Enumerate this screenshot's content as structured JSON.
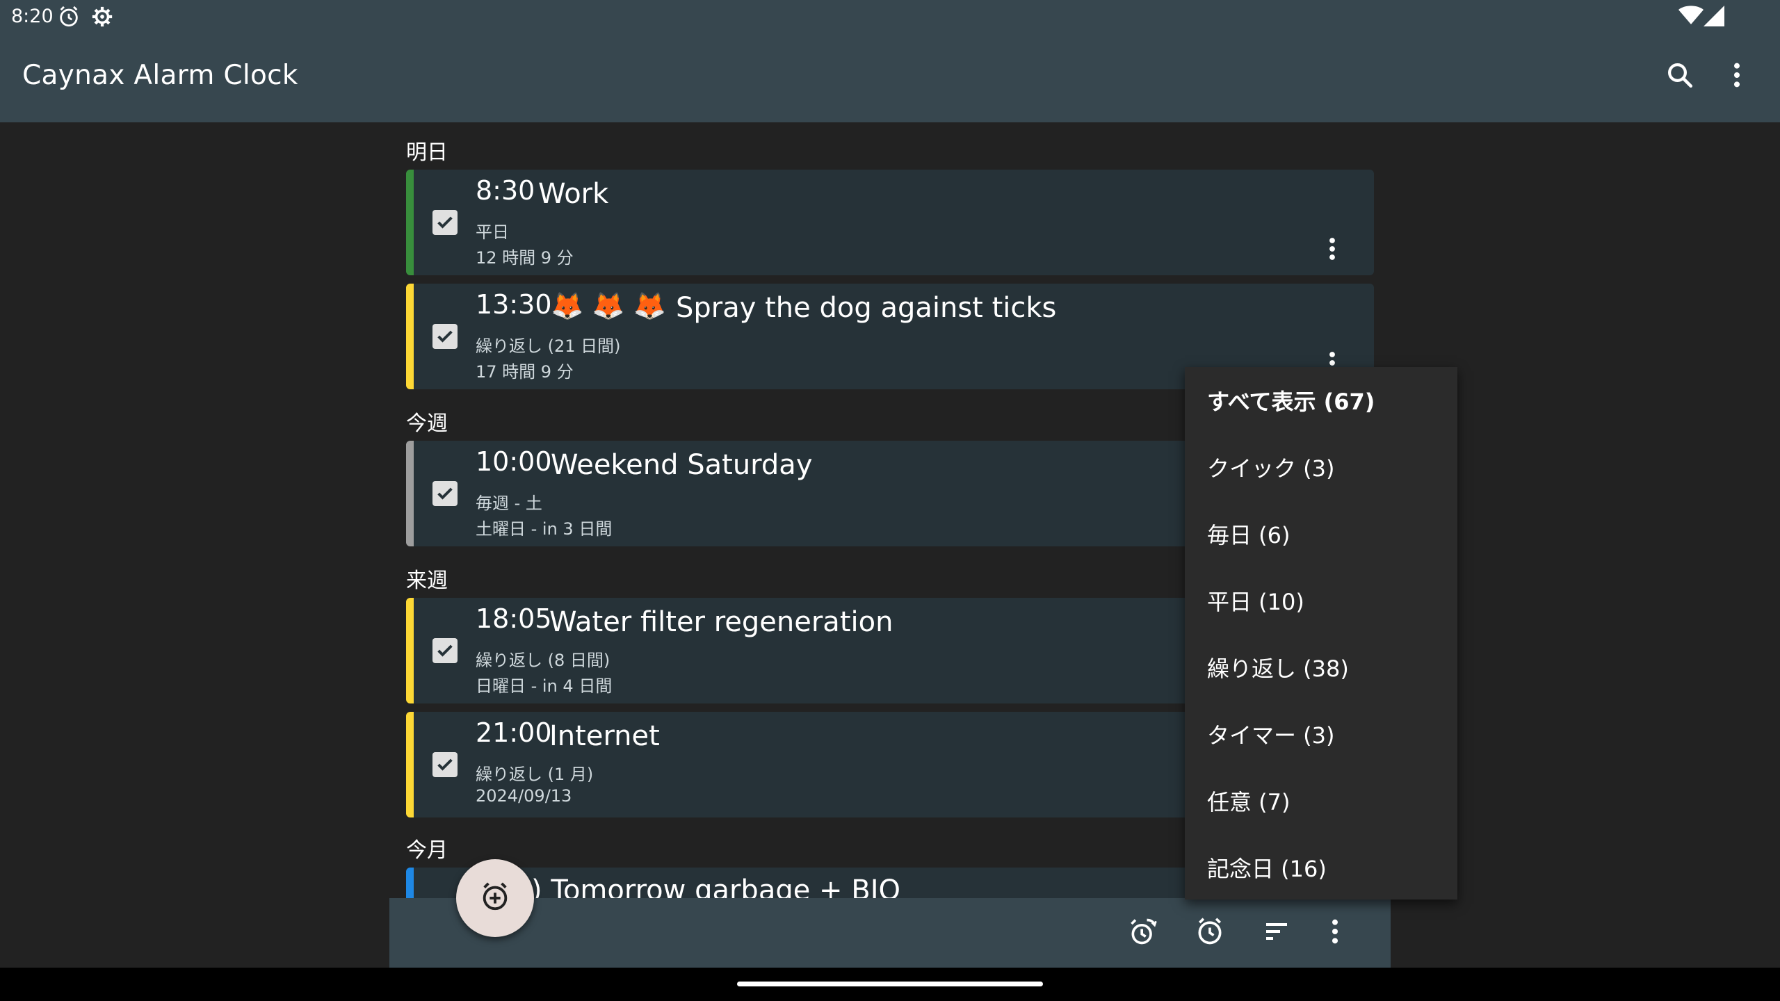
{
  "status_bar": {
    "time": "8:20",
    "left_icons": [
      "alarm-clock-icon",
      "gear-icon"
    ],
    "right_icons": [
      "wifi-icon",
      "cell-signal-icon"
    ]
  },
  "app_bar": {
    "title": "Caynax Alarm Clock",
    "actions": [
      "search-icon",
      "more-vert-icon"
    ]
  },
  "sections": [
    {
      "header": "明日",
      "alarms": [
        {
          "time": "8:30",
          "name": "Work",
          "schedule": "平日",
          "remaining": "12 時間 9 分",
          "color": "#388e3c",
          "enabled": true
        },
        {
          "time": "13:30",
          "name": "Spray the dog against ticks",
          "emoji": "🦊 🦊 🦊",
          "schedule": "繰り返し (21 日間)",
          "remaining": "17 時間 9 分",
          "color": "#fdd835",
          "enabled": true
        }
      ]
    },
    {
      "header": "今週",
      "alarms": [
        {
          "time": "10:00",
          "name": "Weekend Saturday",
          "schedule": "毎週 - 土",
          "remaining": "土曜日 - in 3 日間",
          "color": "#9e9e9e",
          "enabled": true
        }
      ]
    },
    {
      "header": "来週",
      "alarms": [
        {
          "time": "18:05",
          "name": "Water filter regeneration",
          "schedule": "繰り返し (8 日間)",
          "remaining": "日曜日 - in 4 日間",
          "color": "#fdd835",
          "enabled": true
        },
        {
          "time": "21:00",
          "name": "Internet",
          "schedule": "繰り返し (1 月)",
          "remaining": "2024/09/13",
          "color": "#fdd835",
          "enabled": true
        }
      ]
    },
    {
      "header": "今月",
      "alarms": [
        {
          "time": "",
          "name": ") Tomorrow garbage + BIO",
          "color": "#1e88e5",
          "enabled": true
        }
      ]
    }
  ],
  "filter_menu": {
    "items": [
      {
        "label": "すべて表示 (67)",
        "selected": true
      },
      {
        "label": "クイック (3)",
        "selected": false
      },
      {
        "label": "毎日 (6)",
        "selected": false
      },
      {
        "label": "平日 (10)",
        "selected": false
      },
      {
        "label": "繰り返し (38)",
        "selected": false
      },
      {
        "label": "タイマー (3)",
        "selected": false
      },
      {
        "label": "任意 (7)",
        "selected": false
      },
      {
        "label": "記念日 (16)",
        "selected": false
      }
    ]
  },
  "bottom_bar": {
    "fab_icon": "add-alarm-icon",
    "actions": [
      "snooze-alarm-icon",
      "alarm-icon",
      "sort-icon",
      "more-vert-icon"
    ]
  },
  "colors": {
    "app_bar": "#37474f",
    "background": "#222222",
    "card": "#263238",
    "menu": "#2b2b2b",
    "fab": "#e8dcd8"
  }
}
